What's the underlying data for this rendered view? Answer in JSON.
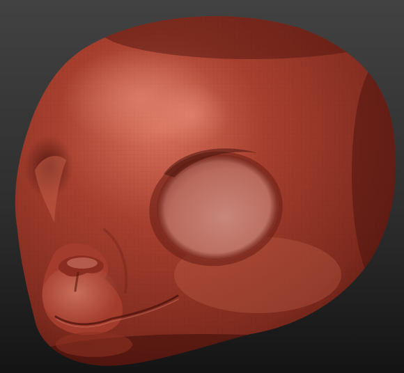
{
  "scene": {
    "subject": "sculpted-creature-head",
    "colors": {
      "background_top": "#424242",
      "background_bottom": "#141414",
      "clay_base": "#a8402f",
      "clay_highlight": "#d9735e",
      "clay_shadow": "#5a1810",
      "eye_socket_fill": "#b86a5c",
      "eye_socket_rim": "#7a2418"
    }
  }
}
